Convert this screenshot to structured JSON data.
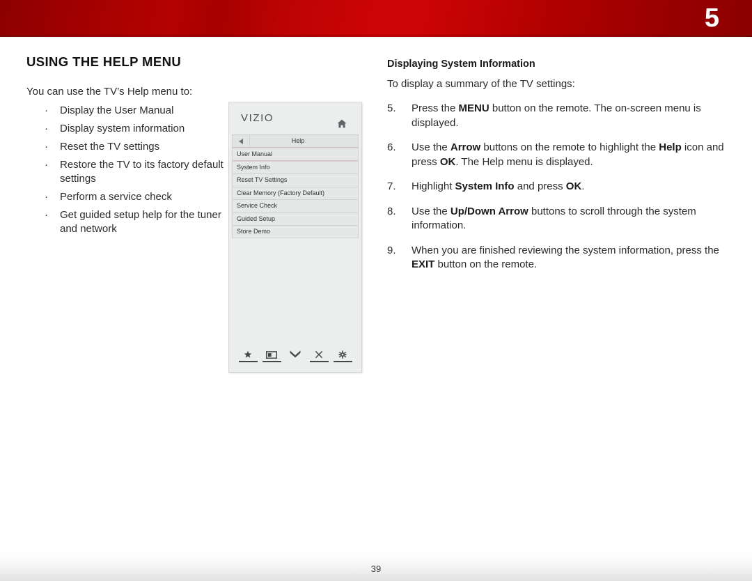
{
  "header": {
    "chapter_number": "5",
    "band_color_left": "#8c0000",
    "band_color_center": "#cf0505",
    "band_color_right": "#8b0000",
    "number_color": "#ffffff"
  },
  "footer": {
    "page_number": "39"
  },
  "left_column": {
    "section_title": "USING THE HELP MENU",
    "intro": "You can use the TV’s Help menu to:",
    "bullet_char": "·",
    "bullets": [
      "Display the User Manual",
      "Display system information",
      "Reset the TV settings",
      "Restore the TV to its factory default settings",
      "Perform a service check",
      "Get guided setup help for the tuner and network"
    ]
  },
  "right_column": {
    "subsection_title": "Displaying System Information",
    "lead_line": "To display a summary of the TV settings:",
    "steps": [
      {
        "number": "5.",
        "parts": [
          {
            "text": "Press the ",
            "bold": false
          },
          {
            "text": "MENU",
            "bold": true
          },
          {
            "text": " button on the remote. The on-screen menu is displayed.",
            "bold": false
          }
        ]
      },
      {
        "number": "6.",
        "parts": [
          {
            "text": "Use the ",
            "bold": false
          },
          {
            "text": "Arrow",
            "bold": true
          },
          {
            "text": " buttons on the remote to highlight the ",
            "bold": false
          },
          {
            "text": "Help",
            "bold": true
          },
          {
            "text": " icon and press ",
            "bold": false
          },
          {
            "text": "OK",
            "bold": true
          },
          {
            "text": ". The Help menu is displayed.",
            "bold": false
          }
        ]
      },
      {
        "number": "7.",
        "parts": [
          {
            "text": "Highlight ",
            "bold": false
          },
          {
            "text": "System Info",
            "bold": true
          },
          {
            "text": " and press ",
            "bold": false
          },
          {
            "text": "OK",
            "bold": true
          },
          {
            "text": ".",
            "bold": false
          }
        ]
      },
      {
        "number": "8.",
        "parts": [
          {
            "text": "Use the ",
            "bold": false
          },
          {
            "text": "Up/Down Arrow",
            "bold": true
          },
          {
            "text": " buttons to scroll through the system information.",
            "bold": false
          }
        ]
      },
      {
        "number": "9.",
        "parts": [
          {
            "text": "When you are finished reviewing the system information, press the ",
            "bold": false
          },
          {
            "text": "EXIT",
            "bold": true
          },
          {
            "text": " button on the remote.",
            "bold": false
          }
        ]
      }
    ]
  },
  "tv_menu": {
    "brand": "VIZIO",
    "home_icon": "home-icon",
    "back_icon": "back-arrow-icon",
    "header_label": "Help",
    "items": [
      "User Manual",
      "System Info",
      "Reset TV Settings",
      "Clear Memory (Factory Default)",
      "Service Check",
      "Guided Setup",
      "Store Demo"
    ],
    "bottom_icons": [
      "star-icon",
      "picture-mode-icon",
      "chevron-double-down-icon",
      "close-x-icon",
      "gear-icon"
    ],
    "panel_bg": "#eceeed",
    "row_bg": "#e6e8e7",
    "accent_line": "#e0bcbc"
  }
}
